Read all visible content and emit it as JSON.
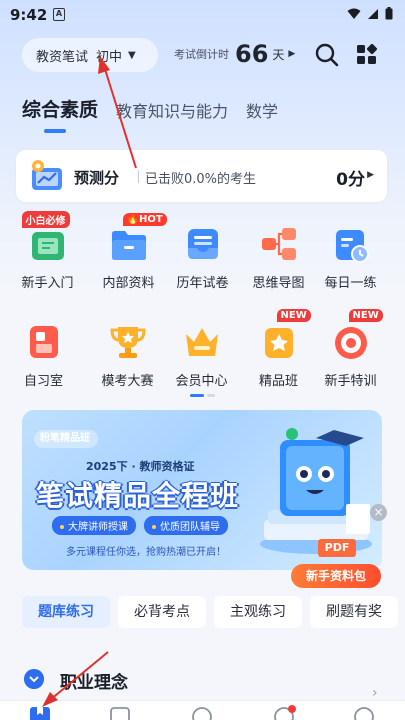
{
  "status_bar": {
    "time": "9:42",
    "notification_letter": "A"
  },
  "header": {
    "exam_type": "教资笔试",
    "level": "初中",
    "countdown_label": "考试倒计时",
    "countdown_value": "66",
    "countdown_unit": "天"
  },
  "top_tabs": [
    {
      "label": "综合素质",
      "active": true
    },
    {
      "label": "教育知识与能力",
      "active": false
    },
    {
      "label": "数学",
      "active": false
    }
  ],
  "predict": {
    "title": "预测分",
    "subtitle": "已击败0.0%的考生",
    "score": "0分"
  },
  "features_row1": [
    {
      "label": "新手入门",
      "icon": "book-icon",
      "badge": "小白必修"
    },
    {
      "label": "内部资料",
      "icon": "folder-icon",
      "badge": "HOT"
    },
    {
      "label": "历年试卷",
      "icon": "paper-tray-icon",
      "badge": ""
    },
    {
      "label": "思维导图",
      "icon": "mindmap-icon",
      "badge": ""
    },
    {
      "label": "每日一练",
      "icon": "calendar-icon",
      "badge": ""
    }
  ],
  "features_row2": [
    {
      "label": "自习室",
      "icon": "study-room-icon",
      "badge": ""
    },
    {
      "label": "模考大赛",
      "icon": "trophy-icon",
      "badge": ""
    },
    {
      "label": "会员中心",
      "icon": "crown-icon",
      "badge": ""
    },
    {
      "label": "精品班",
      "icon": "star-icon",
      "badge": "NEW"
    },
    {
      "label": "新手特训",
      "icon": "target-icon",
      "badge": "NEW"
    }
  ],
  "banner": {
    "brand": "粉笔精品班",
    "subtitle": "2025下 · 教师资格证",
    "title": "笔试精品全程班",
    "pill1": "大牌讲师授课",
    "pill2": "优质团队辅导",
    "footer": "多元课程任你选，抢购热潮已开启！",
    "pdf_tag": "PDF",
    "cta": "新手资料包"
  },
  "practice_tabs": [
    {
      "label": "题库练习",
      "active": true
    },
    {
      "label": "必背考点",
      "active": false
    },
    {
      "label": "主观练习",
      "active": false
    },
    {
      "label": "刷题有奖",
      "active": false
    }
  ],
  "section": {
    "title": "职业理念"
  },
  "colors": {
    "accent": "#2f7bff",
    "badge_red": "#f03b3b",
    "cta_orange": "#ff5a2e"
  }
}
